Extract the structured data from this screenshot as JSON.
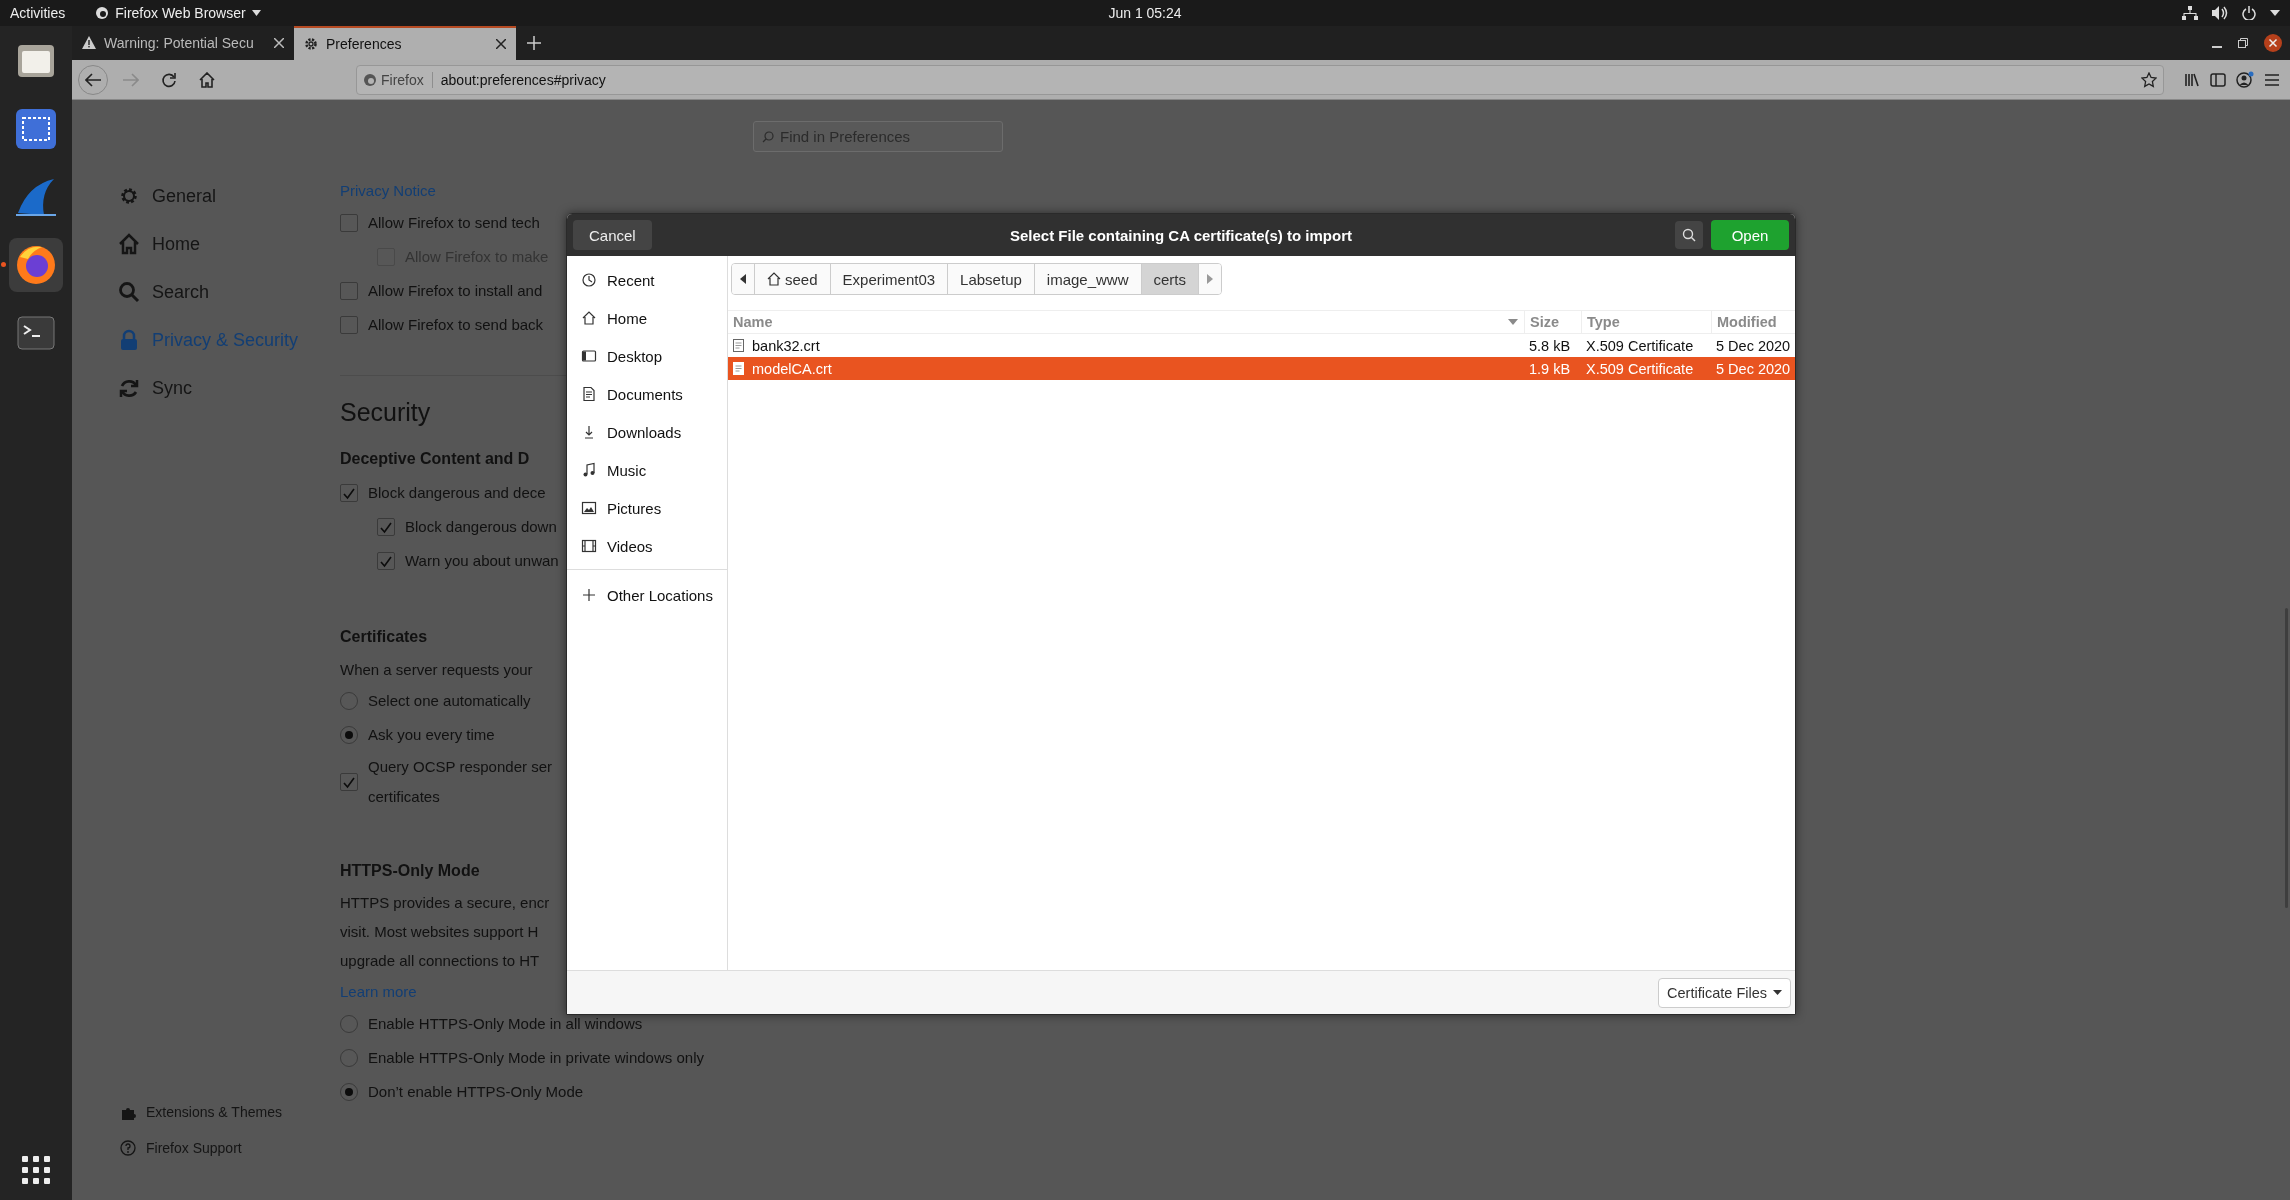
{
  "top_bar": {
    "activities": "Activities",
    "app_menu": "Firefox Web Browser",
    "clock": "Jun 1  05:24"
  },
  "dock": {
    "items": [
      {
        "kind": "files",
        "selected": false
      },
      {
        "kind": "screenshot",
        "selected": false
      },
      {
        "kind": "fin",
        "selected": false
      },
      {
        "kind": "browser",
        "selected": true
      },
      {
        "kind": "terminal",
        "selected": false
      }
    ]
  },
  "browser": {
    "tabs": [
      {
        "title": "Warning: Potential Secu",
        "kind": "warning",
        "selected": false
      },
      {
        "title": "Preferences",
        "kind": "settings",
        "selected": true
      }
    ],
    "forward_disabled": true,
    "identity": "Firefox",
    "url": "about:preferences#privacy"
  },
  "preferences": {
    "search_placeholder": "Find in Preferences",
    "categories": [
      {
        "label": "General",
        "kind": "general",
        "selected": false
      },
      {
        "label": "Home",
        "kind": "home",
        "selected": false
      },
      {
        "label": "Search",
        "kind": "search",
        "selected": false
      },
      {
        "label": "Privacy & Security",
        "kind": "privacy",
        "selected": true
      },
      {
        "label": "Sync",
        "kind": "sync",
        "selected": false
      }
    ],
    "footer_links": [
      {
        "label": "Extensions & Themes",
        "kind": "extensions"
      },
      {
        "label": "Firefox Support",
        "kind": "support"
      }
    ],
    "content": [
      {
        "kind": "link",
        "text": "Privacy Notice"
      },
      {
        "kind": "checkbox",
        "text": "Allow Firefox to send tech",
        "checked": false,
        "disabled": false,
        "children": [
          {
            "kind": "checkbox",
            "text": "Allow Firefox to make",
            "checked": false,
            "disabled": true
          }
        ]
      },
      {
        "kind": "checkbox",
        "text": "Allow Firefox to install and",
        "checked": false,
        "disabled": false
      },
      {
        "kind": "checkbox",
        "text": "Allow Firefox to send back",
        "checked": false,
        "disabled": false
      },
      {
        "kind": "divider"
      },
      {
        "kind": "heading",
        "text": "Security"
      },
      {
        "kind": "subheading",
        "text": "Deceptive Content and D"
      },
      {
        "kind": "checkbox",
        "text": "Block dangerous and dece",
        "checked": true,
        "disabled": false,
        "children": [
          {
            "kind": "checkbox",
            "text": "Block dangerous down",
            "checked": true,
            "disabled": false
          },
          {
            "kind": "checkbox",
            "text": "Warn you about unwan",
            "checked": true,
            "disabled": false
          }
        ]
      },
      {
        "kind": "subheading",
        "text": "Certificates"
      },
      {
        "kind": "text",
        "text": "When a server requests your"
      },
      {
        "kind": "radio",
        "text": "Select one automatically",
        "selected": false
      },
      {
        "kind": "radio",
        "text": "Ask you every time",
        "selected": true
      },
      {
        "kind": "checkbox",
        "text": "Query OCSP responder ser\ncertificates",
        "checked": true,
        "disabled": false
      },
      {
        "kind": "subheading",
        "text": "HTTPS-Only Mode"
      },
      {
        "kind": "paragraph",
        "lines": [
          "HTTPS provides a secure, encr",
          "visit. Most websites support H",
          "upgrade all connections to HT"
        ]
      },
      {
        "kind": "link",
        "text": "Learn more"
      },
      {
        "kind": "radio",
        "text": "Enable HTTPS-Only Mode in all windows",
        "selected": false
      },
      {
        "kind": "radio",
        "text": "Enable HTTPS-Only Mode in private windows only",
        "selected": false
      },
      {
        "kind": "radio",
        "text": "Don’t enable HTTPS-Only Mode",
        "selected": true
      }
    ]
  },
  "dialog": {
    "title": "Select File containing CA certificate(s) to import",
    "cancel": "Cancel",
    "open": "Open",
    "places": [
      {
        "label": "Recent",
        "kind": "recent"
      },
      {
        "label": "Home",
        "kind": "home"
      },
      {
        "label": "Desktop",
        "kind": "desktop"
      },
      {
        "label": "Documents",
        "kind": "documents"
      },
      {
        "label": "Downloads",
        "kind": "downloads"
      },
      {
        "label": "Music",
        "kind": "music"
      },
      {
        "label": "Pictures",
        "kind": "pictures"
      },
      {
        "label": "Videos",
        "kind": "videos"
      },
      {
        "label": "Other Locations",
        "kind": "other"
      }
    ],
    "path": [
      {
        "label": "seed",
        "kind": "home",
        "selected": false
      },
      {
        "label": "Experiment03",
        "kind": "folder",
        "selected": false
      },
      {
        "label": "Labsetup",
        "kind": "folder",
        "selected": false
      },
      {
        "label": "image_www",
        "kind": "folder",
        "selected": false
      },
      {
        "label": "certs",
        "kind": "folder",
        "selected": true
      }
    ],
    "columns": [
      {
        "label": "Name",
        "sorted": true
      },
      {
        "label": "Size",
        "sorted": false
      },
      {
        "label": "Type",
        "sorted": false
      },
      {
        "label": "Modified",
        "sorted": false
      }
    ],
    "rows": [
      {
        "name": "bank32.crt",
        "size": "5.8 kB",
        "type": "X.509 Certificate",
        "modified": "5 Dec 2020",
        "selected": false
      },
      {
        "name": "modelCA.crt",
        "size": "1.9 kB",
        "type": "X.509 Certificate",
        "modified": "5 Dec 2020",
        "selected": true
      }
    ],
    "filter": "Certificate Files"
  }
}
